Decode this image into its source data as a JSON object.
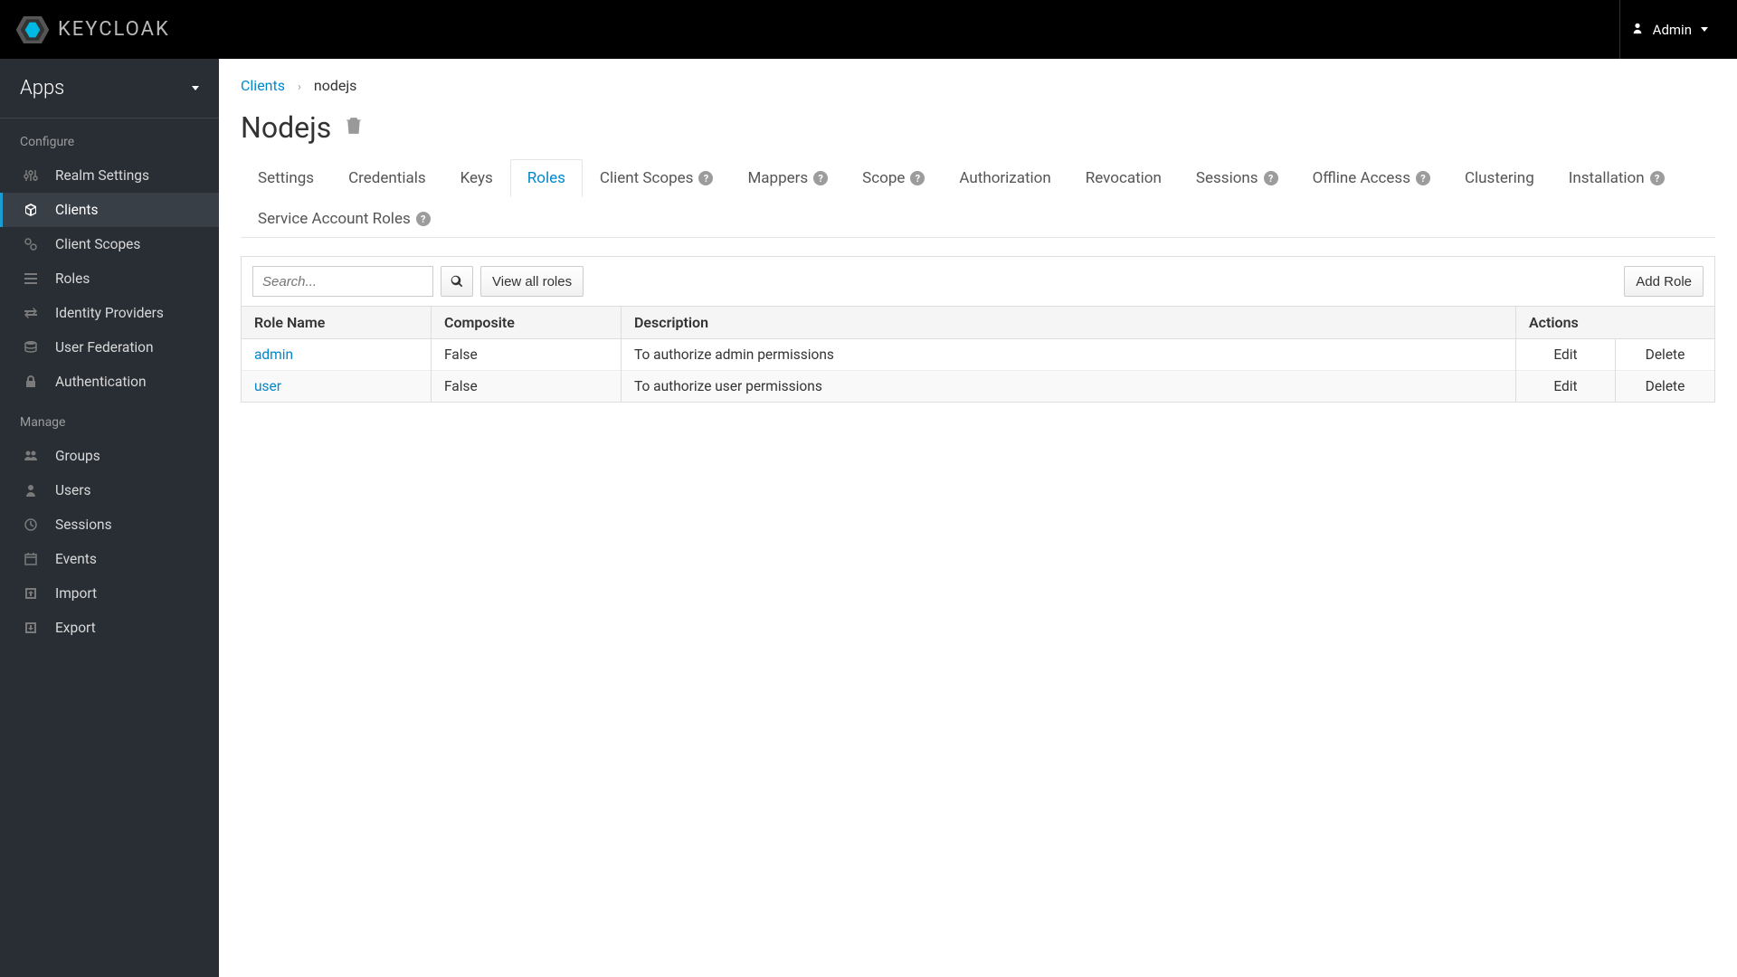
{
  "brand": {
    "name": "KEYCLOAK"
  },
  "user": {
    "label": "Admin"
  },
  "realm": {
    "name": "Apps"
  },
  "sidebar": {
    "sections": [
      {
        "title": "Configure",
        "items": [
          {
            "label": "Realm Settings",
            "icon": "sliders"
          },
          {
            "label": "Clients",
            "icon": "cube",
            "active": true
          },
          {
            "label": "Client Scopes",
            "icon": "scopes"
          },
          {
            "label": "Roles",
            "icon": "list"
          },
          {
            "label": "Identity Providers",
            "icon": "exchange"
          },
          {
            "label": "User Federation",
            "icon": "database"
          },
          {
            "label": "Authentication",
            "icon": "lock"
          }
        ]
      },
      {
        "title": "Manage",
        "items": [
          {
            "label": "Groups",
            "icon": "group"
          },
          {
            "label": "Users",
            "icon": "user"
          },
          {
            "label": "Sessions",
            "icon": "clock"
          },
          {
            "label": "Events",
            "icon": "calendar"
          },
          {
            "label": "Import",
            "icon": "import"
          },
          {
            "label": "Export",
            "icon": "export"
          }
        ]
      }
    ]
  },
  "breadcrumb": {
    "parent": "Clients",
    "current": "nodejs"
  },
  "page": {
    "title": "Nodejs"
  },
  "tabs": [
    {
      "label": "Settings"
    },
    {
      "label": "Credentials"
    },
    {
      "label": "Keys"
    },
    {
      "label": "Roles",
      "active": true
    },
    {
      "label": "Client Scopes",
      "help": true
    },
    {
      "label": "Mappers",
      "help": true
    },
    {
      "label": "Scope",
      "help": true
    },
    {
      "label": "Authorization"
    },
    {
      "label": "Revocation"
    },
    {
      "label": "Sessions",
      "help": true
    },
    {
      "label": "Offline Access",
      "help": true
    },
    {
      "label": "Clustering"
    },
    {
      "label": "Installation",
      "help": true
    },
    {
      "label": "Service Account Roles",
      "help": true
    }
  ],
  "toolbar": {
    "search_placeholder": "Search...",
    "view_all": "View all roles",
    "add": "Add Role"
  },
  "table": {
    "columns": {
      "name": "Role Name",
      "composite": "Composite",
      "description": "Description",
      "actions": "Actions"
    },
    "action_labels": {
      "edit": "Edit",
      "delete": "Delete"
    },
    "rows": [
      {
        "name": "admin",
        "composite": "False",
        "description": "To authorize admin permissions"
      },
      {
        "name": "user",
        "composite": "False",
        "description": "To authorize user permissions"
      }
    ]
  }
}
